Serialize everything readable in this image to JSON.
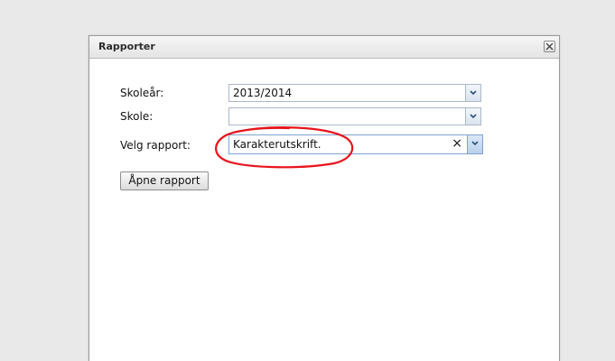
{
  "dialog": {
    "title": "Rapporter",
    "close_icon": "close-icon"
  },
  "form": {
    "school_year_label": "Skoleår:",
    "school_year_value": "2013/2014",
    "school_label": "Skole:",
    "school_value": "",
    "report_label": "Velg rapport:",
    "report_value": "Karakterutskrift.",
    "clear_symbol": "×",
    "open_button": "Åpne rapport"
  },
  "colors": {
    "annotation": "#e8141b",
    "trigger_border": "#a9b8c9"
  }
}
